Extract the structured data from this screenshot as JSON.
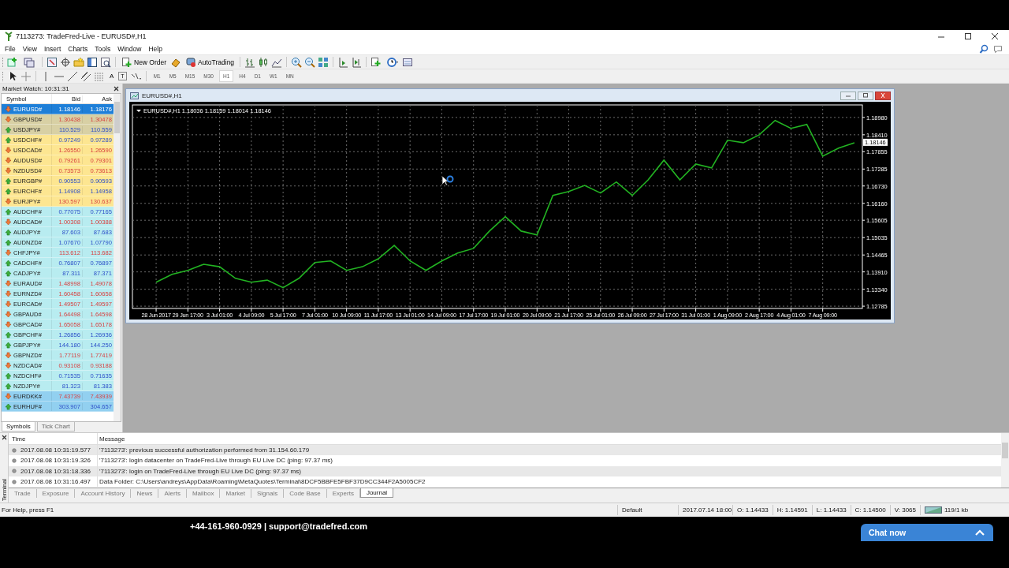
{
  "window": {
    "title": "7113273: TradeFred-Live - EURUSD#,H1"
  },
  "menu": [
    "File",
    "View",
    "Insert",
    "Charts",
    "Tools",
    "Window",
    "Help"
  ],
  "toolbar": {
    "buttons": [
      {
        "label": "New Order"
      },
      {
        "label": "AutoTrading"
      }
    ]
  },
  "text_tools": [
    "A",
    "T"
  ],
  "timeframes": [
    {
      "label": "M1",
      "selected": false
    },
    {
      "label": "M5",
      "selected": false
    },
    {
      "label": "M15",
      "selected": false
    },
    {
      "label": "M30",
      "selected": false
    },
    {
      "label": "H1",
      "selected": true
    },
    {
      "label": "H4",
      "selected": false
    },
    {
      "label": "D1",
      "selected": false
    },
    {
      "label": "W1",
      "selected": false
    },
    {
      "label": "MN",
      "selected": false
    }
  ],
  "market_watch": {
    "title": "Market Watch: 10:31:31",
    "columns": [
      "Symbol",
      "Bid",
      "Ask"
    ],
    "rows": [
      {
        "symbol": "EURUSD#",
        "bid": "1.18146",
        "ask": "1.18176",
        "rising": false,
        "color": "#1e7fd8",
        "selected": true
      },
      {
        "symbol": "GBPUSD#",
        "bid": "1.30438",
        "ask": "1.30478",
        "rising": false,
        "color": "#d8d0a4",
        "selected": false
      },
      {
        "symbol": "USDJPY#",
        "bid": "110.529",
        "ask": "110.559",
        "rising": true,
        "color": "#d8d0a4",
        "selected": false
      },
      {
        "symbol": "USDCHF#",
        "bid": "0.97249",
        "ask": "0.97289",
        "rising": true,
        "color": "#fde691",
        "selected": false
      },
      {
        "symbol": "USDCAD#",
        "bid": "1.26550",
        "ask": "1.26590",
        "rising": false,
        "color": "#fde691",
        "selected": false
      },
      {
        "symbol": "AUDUSD#",
        "bid": "0.79261",
        "ask": "0.79301",
        "rising": false,
        "color": "#fde691",
        "selected": false
      },
      {
        "symbol": "NZDUSD#",
        "bid": "0.73573",
        "ask": "0.73613",
        "rising": false,
        "color": "#fde691",
        "selected": false
      },
      {
        "symbol": "EURGBP#",
        "bid": "0.90553",
        "ask": "0.90593",
        "rising": true,
        "color": "#fde691",
        "selected": false
      },
      {
        "symbol": "EURCHF#",
        "bid": "1.14908",
        "ask": "1.14958",
        "rising": true,
        "color": "#fde691",
        "selected": false
      },
      {
        "symbol": "EURJPY#",
        "bid": "130.597",
        "ask": "130.637",
        "rising": false,
        "color": "#fde691",
        "selected": false
      },
      {
        "symbol": "AUDCHF#",
        "bid": "0.77075",
        "ask": "0.77165",
        "rising": true,
        "color": "#b8ecf0",
        "selected": false
      },
      {
        "symbol": "AUDCAD#",
        "bid": "1.00308",
        "ask": "1.00388",
        "rising": false,
        "color": "#b8ecf0",
        "selected": false
      },
      {
        "symbol": "AUDJPY#",
        "bid": "87.603",
        "ask": "87.683",
        "rising": true,
        "color": "#b8ecf0",
        "selected": false
      },
      {
        "symbol": "AUDNZD#",
        "bid": "1.07670",
        "ask": "1.07790",
        "rising": true,
        "color": "#b8ecf0",
        "selected": false
      },
      {
        "symbol": "CHFJPY#",
        "bid": "113.612",
        "ask": "113.682",
        "rising": false,
        "color": "#b8ecf0",
        "selected": false
      },
      {
        "symbol": "CADCHF#",
        "bid": "0.76807",
        "ask": "0.76897",
        "rising": true,
        "color": "#b8ecf0",
        "selected": false
      },
      {
        "symbol": "CADJPY#",
        "bid": "87.311",
        "ask": "87.371",
        "rising": true,
        "color": "#b8ecf0",
        "selected": false
      },
      {
        "symbol": "EURAUD#",
        "bid": "1.48998",
        "ask": "1.49078",
        "rising": false,
        "color": "#b8ecf0",
        "selected": false
      },
      {
        "symbol": "EURNZD#",
        "bid": "1.60458",
        "ask": "1.60658",
        "rising": false,
        "color": "#b8ecf0",
        "selected": false
      },
      {
        "symbol": "EURCAD#",
        "bid": "1.49507",
        "ask": "1.49597",
        "rising": false,
        "color": "#b8ecf0",
        "selected": false
      },
      {
        "symbol": "GBPAUD#",
        "bid": "1.64498",
        "ask": "1.64598",
        "rising": false,
        "color": "#b8ecf0",
        "selected": false
      },
      {
        "symbol": "GBPCAD#",
        "bid": "1.65058",
        "ask": "1.65178",
        "rising": false,
        "color": "#b8ecf0",
        "selected": false
      },
      {
        "symbol": "GBPCHF#",
        "bid": "1.26856",
        "ask": "1.26936",
        "rising": true,
        "color": "#b8ecf0",
        "selected": false
      },
      {
        "symbol": "GBPJPY#",
        "bid": "144.180",
        "ask": "144.250",
        "rising": true,
        "color": "#b8ecf0",
        "selected": false
      },
      {
        "symbol": "GBPNZD#",
        "bid": "1.77119",
        "ask": "1.77419",
        "rising": false,
        "color": "#b8ecf0",
        "selected": false
      },
      {
        "symbol": "NZDCAD#",
        "bid": "0.93108",
        "ask": "0.93188",
        "rising": false,
        "color": "#b8ecf0",
        "selected": false
      },
      {
        "symbol": "NZDCHF#",
        "bid": "0.71535",
        "ask": "0.71635",
        "rising": true,
        "color": "#b8ecf0",
        "selected": false
      },
      {
        "symbol": "NZDJPY#",
        "bid": "81.323",
        "ask": "81.383",
        "rising": true,
        "color": "#b8ecf0",
        "selected": false
      },
      {
        "symbol": "EURDKK#",
        "bid": "7.43739",
        "ask": "7.43939",
        "rising": false,
        "color": "#92d0f0",
        "selected": false
      },
      {
        "symbol": "EURHUF#",
        "bid": "303.907",
        "ask": "304.657",
        "rising": true,
        "color": "#92d0f0",
        "selected": false
      }
    ],
    "tabs": [
      {
        "label": "Symbols",
        "selected": true
      },
      {
        "label": "Tick Chart",
        "selected": false
      }
    ]
  },
  "chart_window": {
    "title": "EURUSD#,H1",
    "header": "EURUSD#,H1  1.18036 1.18159 1.18014 1.18146",
    "price_tag": "1.18146",
    "chart_data": {
      "type": "line",
      "ylim": [
        1.1271,
        1.1939
      ],
      "grid": true,
      "categories": [
        "28 Jun 2017",
        null,
        "29 Jun 17:00",
        null,
        "3 Jul 01:00",
        null,
        "4 Jul 09:00",
        null,
        "5 Jul 17:00",
        null,
        "7 Jul 01:00",
        null,
        "10 Jul 09:00",
        null,
        "11 Jul 17:00",
        null,
        "13 Jul 01:00",
        null,
        "14 Jul 09:00",
        null,
        "17 Jul 17:00",
        null,
        "19 Jul 01:00",
        null,
        "20 Jul 09:00",
        null,
        "21 Jul 17:00",
        null,
        "25 Jul 01:00",
        null,
        "26 Jul 09:00",
        null,
        "27 Jul 17:00",
        null,
        "31 Jul 01:00",
        null,
        "1 Aug 09:00",
        null,
        "2 Aug 17:00",
        null,
        "4 Aug 01:00",
        null,
        "7 Aug 09:00",
        null,
        null
      ],
      "series": [
        {
          "color": "#22b322",
          "values": [
            1.1357,
            1.1383,
            1.1396,
            1.1416,
            1.1408,
            1.137,
            1.1357,
            1.1364,
            1.1339,
            1.137,
            1.1422,
            1.1427,
            1.1396,
            1.1408,
            1.1434,
            1.1478,
            1.1427,
            1.1396,
            1.1427,
            1.1453,
            1.1468,
            1.1525,
            1.1572,
            1.1525,
            1.1512,
            1.1642,
            1.1655,
            1.1675,
            1.165,
            1.1686,
            1.1642,
            1.1693,
            1.1758,
            1.1693,
            1.1745,
            1.1732,
            1.1823,
            1.1815,
            1.1841,
            1.1888,
            1.1862,
            1.1875,
            1.1771,
            1.1797,
            1.1815
          ]
        }
      ],
      "yticks": [
        {
          "value": 1.1898,
          "label": "1.18980"
        },
        {
          "value": 1.1841,
          "label": "1.18410"
        },
        {
          "value": 1.17855,
          "label": "1.17855"
        },
        {
          "value": 1.17285,
          "label": "1.17285"
        },
        {
          "value": 1.1673,
          "label": "1.16730"
        },
        {
          "value": 1.1616,
          "label": "1.16160"
        },
        {
          "value": 1.15605,
          "label": "1.15605"
        },
        {
          "value": 1.15035,
          "label": "1.15035"
        },
        {
          "value": 1.14465,
          "label": "1.14465"
        },
        {
          "value": 1.1391,
          "label": "1.13910"
        },
        {
          "value": 1.1334,
          "label": "1.13340"
        },
        {
          "value": 1.12785,
          "label": "1.12785"
        }
      ]
    }
  },
  "terminal": {
    "label": "Terminal",
    "columns": [
      "Time",
      "Message"
    ],
    "rows": [
      {
        "time": "2017.08.08 10:31:19.577",
        "message": "'7113273': previous successful authorization performed from 31.154.60.179"
      },
      {
        "time": "2017.08.08 10:31:19.326",
        "message": "'7113273': login datacenter on TradeFred-Live through EU Live DC (ping: 97.37 ms)"
      },
      {
        "time": "2017.08.08 10:31:18.336",
        "message": "'7113273': login on TradeFred-Live through EU Live DC (ping: 97.37 ms)"
      },
      {
        "time": "2017.08.08 10:31:16.497",
        "message": "Data Folder: C:\\Users\\andreys\\AppData\\Roaming\\MetaQuotes\\Terminal\\8DCF5BBFE5FBF37D9CC344F2A5005CF2"
      }
    ],
    "tabs": [
      {
        "label": "Trade",
        "selected": false
      },
      {
        "label": "Exposure",
        "selected": false
      },
      {
        "label": "Account History",
        "selected": false
      },
      {
        "label": "News",
        "selected": false
      },
      {
        "label": "Alerts",
        "selected": false
      },
      {
        "label": "Mailbox",
        "selected": false
      },
      {
        "label": "Market",
        "selected": false
      },
      {
        "label": "Signals",
        "selected": false
      },
      {
        "label": "Code Base",
        "selected": false
      },
      {
        "label": "Experts",
        "selected": false
      },
      {
        "label": "Journal",
        "selected": true
      }
    ]
  },
  "status_bar": {
    "help": "For Help, press F1",
    "profile": "Default",
    "fields": [
      "2017.07.14 18:00",
      "O: 1.14433",
      "H: 1.14591",
      "L: 1.14433",
      "C: 1.14500",
      "V: 3065"
    ],
    "traffic": "119/1 kb"
  },
  "footer": {
    "contact": "+44-161-960-0929 | support@tradefred.com",
    "chat_button": "Chat now"
  }
}
